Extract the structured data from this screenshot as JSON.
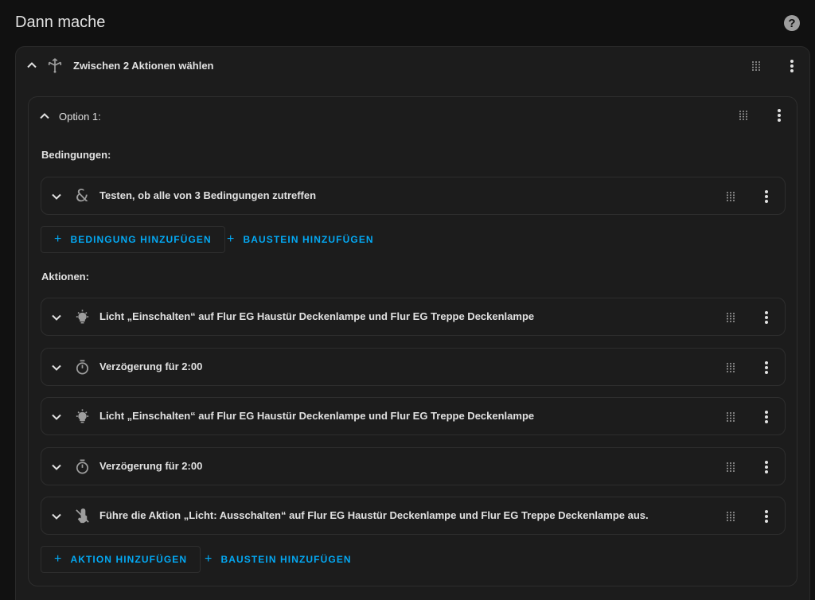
{
  "page": {
    "title": "Dann mache",
    "help": "?"
  },
  "choose": {
    "label": "Zwischen 2 Aktionen wählen",
    "option": {
      "label": "Option 1:",
      "conditions_heading": "Bedingungen:",
      "conditions": [
        {
          "icon": "ampersand-icon",
          "text": "Testen, ob alle von 3 Bedingungen zutreffen"
        }
      ],
      "condition_buttons": {
        "add_condition": "BEDINGUNG HINZUFÜGEN",
        "add_building_block": "BAUSTEIN HINZUFÜGEN"
      },
      "actions_heading": "Aktionen:",
      "actions": [
        {
          "icon": "lightbulb-on-icon",
          "text": "Licht „Einschalten“ auf Flur EG Haustür Deckenlampe und Flur EG Treppe Deckenlampe"
        },
        {
          "icon": "timer-icon",
          "text": "Verzögerung für 2:00"
        },
        {
          "icon": "lightbulb-on-icon",
          "text": "Licht „Einschalten“ auf Flur EG Haustür Deckenlampe und Flur EG Treppe Deckenlampe"
        },
        {
          "icon": "timer-icon",
          "text": "Verzögerung für 2:00"
        },
        {
          "icon": "gesture-tap-icon",
          "text": "Führe die Aktion „Licht: Ausschalten“ auf Flur EG Haustür Deckenlampe und Flur EG Treppe Deckenlampe aus."
        }
      ],
      "action_buttons": {
        "add_action": "AKTION HINZUFÜGEN",
        "add_building_block": "BAUSTEIN HINZUFÜGEN"
      }
    }
  },
  "colors": {
    "accent": "#03a9f4",
    "background": "#111111",
    "card": "#1c1c1c",
    "text": "#e1e1e1",
    "icon": "#9e9e9e"
  }
}
